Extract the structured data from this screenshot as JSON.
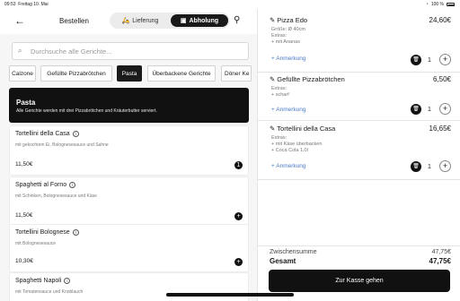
{
  "status_bar": {
    "time": "09:53",
    "date": "Freitag 10. Mai",
    "battery": "100 %"
  },
  "header": {
    "title": "Bestellen",
    "delivery_label": "Lieferung",
    "pickup_label": "Abholung"
  },
  "search": {
    "placeholder": "Durchsuche alle Gerichte..."
  },
  "categories": [
    "Calzone",
    "Gefüllte Pizzabrötchen",
    "Pasta",
    "Überbackene Gerichte",
    "Döner Ke"
  ],
  "banner": {
    "title": "Pasta",
    "description": "Alle Gerichte werden mit drei Pizzabrötchen und Kräuterbutter serviert."
  },
  "menu_items": [
    {
      "name": "Tortellini della Casa",
      "description": "mit gekochtem Ei, Bolognesesauce und Sahne",
      "price": "11,50€"
    },
    {
      "name": "Spaghetti al Forno",
      "description": "mit Schinken, Bolognesesauce und Käse",
      "price": "11,50€"
    },
    {
      "name": "Tortellini Bolognese",
      "description": "mit Bolognesesauce",
      "price": "10,30€"
    },
    {
      "name": "Spaghetti Napoli",
      "description": "mit Tomatensauce und Knoblauch",
      "price": ""
    }
  ],
  "cart": {
    "items": [
      {
        "name": "Pizza Edo",
        "price": "24,60€",
        "lines": [
          "Größe: Ø 40cm",
          "Extras:",
          "+ mit Ananas"
        ],
        "note": "+ Anmerkung",
        "qty": "1"
      },
      {
        "name": "Gefüllte Pizzabrötchen",
        "price": "6,50€",
        "lines": [
          "Extras:",
          "+ scharf"
        ],
        "note": "+ Anmerkung",
        "qty": "1"
      },
      {
        "name": "Tortellini della Casa",
        "price": "16,65€",
        "lines": [
          "Extras:",
          "+ mit Käse überbacken",
          "+ Coca Cola 1,0l"
        ],
        "note": "+ Anmerkung",
        "qty": "1"
      }
    ],
    "subtotal_label": "Zwischensumme",
    "subtotal": "47,75€",
    "total_label": "Gesamt",
    "total": "47,75€",
    "checkout_label": "Zur Kasse gehen"
  }
}
